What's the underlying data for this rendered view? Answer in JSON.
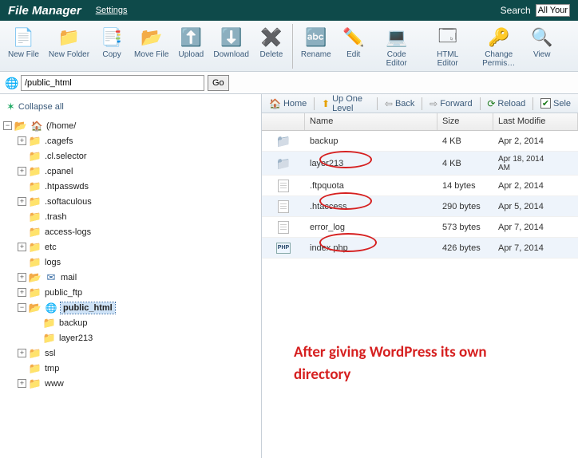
{
  "header": {
    "title": "File Manager",
    "settings": "Settings",
    "search_label": "Search",
    "search_selected": "All Your"
  },
  "toolbar": {
    "new_file": "New File",
    "new_folder": "New\nFolder",
    "copy": "Copy",
    "move_file": "Move File",
    "upload": "Upload",
    "download": "Download",
    "delete": "Delete",
    "rename": "Rename",
    "edit": "Edit",
    "code_editor": "Code\nEditor",
    "html_editor": "HTML\nEditor",
    "change_perms": "Change\nPermis…",
    "view": "View"
  },
  "pathbar": {
    "value": "/public_html",
    "go": "Go"
  },
  "tree": {
    "collapse_all": "Collapse all",
    "root": "(/home/",
    "items": [
      ".cagefs",
      ".cl.selector",
      ".cpanel",
      ".htpasswds",
      ".softaculous",
      ".trash",
      "access-logs",
      "etc",
      "logs",
      "mail",
      "public_ftp",
      "public_html",
      "ssl",
      "tmp",
      "www"
    ],
    "public_html_children": [
      "backup",
      "layer213"
    ]
  },
  "navbar": {
    "home": "Home",
    "up": "Up One Level",
    "back": "Back",
    "forward": "Forward",
    "reload": "Reload",
    "select": "Sele"
  },
  "grid": {
    "headers": {
      "name": "Name",
      "size": "Size",
      "modified": "Last Modifie"
    },
    "rows": [
      {
        "icon": "folder",
        "name": "backup",
        "size": "4 KB",
        "modified": "Apr 2, 2014"
      },
      {
        "icon": "folder",
        "name": "layer213",
        "size": "4 KB",
        "modified": "Apr 18, 2014\nAM"
      },
      {
        "icon": "doc",
        "name": ".ftpquota",
        "size": "14 bytes",
        "modified": "Apr 2, 2014"
      },
      {
        "icon": "doc",
        "name": ".htaccess",
        "size": "290 bytes",
        "modified": "Apr 5, 2014"
      },
      {
        "icon": "doc",
        "name": "error_log",
        "size": "573 bytes",
        "modified": "Apr 7, 2014"
      },
      {
        "icon": "php",
        "name": "index.php",
        "size": "426 bytes",
        "modified": "Apr 7, 2014"
      }
    ]
  },
  "annotation": "After giving WordPress its own directory"
}
